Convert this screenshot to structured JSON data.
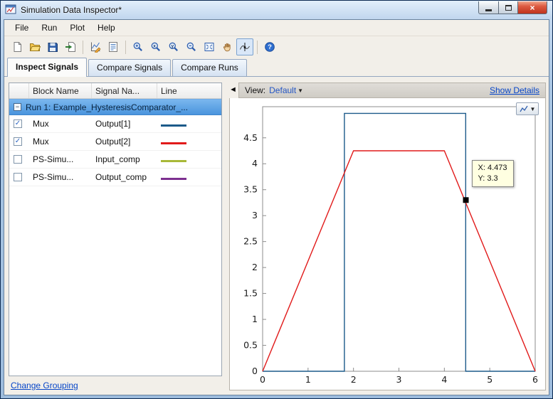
{
  "window": {
    "title": "Simulation Data Inspector*"
  },
  "menu": {
    "items": [
      "File",
      "Run",
      "Plot",
      "Help"
    ]
  },
  "toolbar": {
    "buttons": [
      "new",
      "open",
      "save",
      "import",
      "|",
      "plot-edit",
      "report",
      "|",
      "zoom-in",
      "zoom-x",
      "zoom-y",
      "zoom-out",
      "fit-view",
      "pan",
      "data-cursor",
      "|",
      "help"
    ],
    "active_button": "data-cursor"
  },
  "tabs": [
    {
      "label": "Inspect Signals",
      "active": true
    },
    {
      "label": "Compare Signals",
      "active": false
    },
    {
      "label": "Compare Runs",
      "active": false
    }
  ],
  "signal_table": {
    "headers": [
      "Block Name",
      "Signal Na...",
      "Line"
    ],
    "run_label": "Run 1: Example_HysteresisComparator_...",
    "rows": [
      {
        "checked": true,
        "block": "Mux",
        "signal": "Output[1]",
        "color": "#1c5a8a"
      },
      {
        "checked": true,
        "block": "Mux",
        "signal": "Output[2]",
        "color": "#e11a1a"
      },
      {
        "checked": false,
        "block": "PS-Simu...",
        "signal": "Input_comp",
        "color": "#a8b838"
      },
      {
        "checked": false,
        "block": "PS-Simu...",
        "signal": "Output_comp",
        "color": "#7d3090"
      }
    ],
    "footer_link": "Change Grouping"
  },
  "view_bar": {
    "label": "View:",
    "value": "Default",
    "details_link": "Show Details"
  },
  "cursor_tooltip": {
    "x_label": "X: 4.473",
    "y_label": "Y: 3.3"
  },
  "colors": {
    "selection": "#4a94dd",
    "link": "#0645c8",
    "tooltip_bg": "#ffffe1"
  },
  "chart_data": {
    "type": "line",
    "title": "",
    "xlabel": "",
    "ylabel": "",
    "xlim": [
      0,
      6
    ],
    "ylim": [
      0,
      5.1
    ],
    "grid": false,
    "legend": false,
    "xticks": [
      0,
      1,
      2,
      3,
      4,
      5,
      6
    ],
    "xtick_labels": [
      "0",
      "1",
      "2",
      "3",
      "4",
      "5",
      "6"
    ],
    "yticks": [
      0,
      0.5,
      1,
      1.5,
      2,
      2.5,
      3,
      3.5,
      4,
      4.5
    ],
    "ytick_labels": [
      "0",
      "0.5",
      "1",
      "1.5",
      "2",
      "2.5",
      "3",
      "3.5",
      "4",
      "4.5"
    ],
    "series": [
      {
        "name": "Output[1]",
        "color": "#1c5a8a",
        "x": [
          0,
          1.8,
          1.8,
          4.47,
          4.47,
          6
        ],
        "y": [
          0,
          0,
          4.97,
          4.97,
          0,
          0
        ]
      },
      {
        "name": "Output[2]",
        "color": "#e11a1a",
        "x": [
          0,
          2,
          4,
          6
        ],
        "y": [
          0,
          4.25,
          4.25,
          0
        ]
      }
    ],
    "cursor": {
      "x": 4.473,
      "y": 3.3
    }
  }
}
